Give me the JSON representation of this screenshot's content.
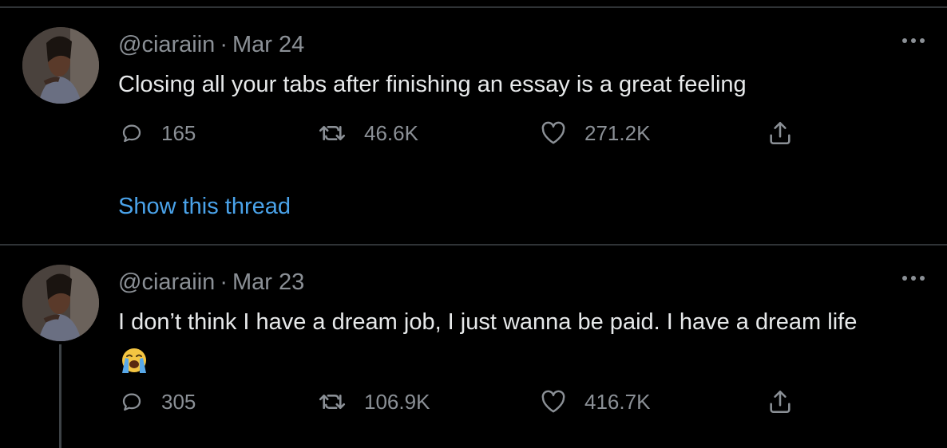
{
  "tweets": [
    {
      "handle": "@ciaraiin",
      "separator": "·",
      "date": "Mar 24",
      "text": "Closing all your tabs after finishing an essay is a great feeling",
      "emoji": "",
      "replies": "165",
      "retweets": "46.6K",
      "likes": "271.2K",
      "show_thread": "Show this thread"
    },
    {
      "handle": "@ciaraiin",
      "separator": "·",
      "date": "Mar 23",
      "text": "I don’t think I have a dream job, I just wanna be paid. I have a dream life",
      "emoji": "loudly-crying-face",
      "replies": "305",
      "retweets": "106.9K",
      "likes": "416.7K"
    }
  ],
  "colors": {
    "background": "#000000",
    "text": "#e7e9ea",
    "muted": "#8b9096",
    "link": "#4aa3ea",
    "divider": "#2f3336"
  },
  "icons": {
    "reply": "reply-icon",
    "retweet": "retweet-icon",
    "like": "heart-icon",
    "share": "share-icon",
    "more": "more-options-icon"
  }
}
